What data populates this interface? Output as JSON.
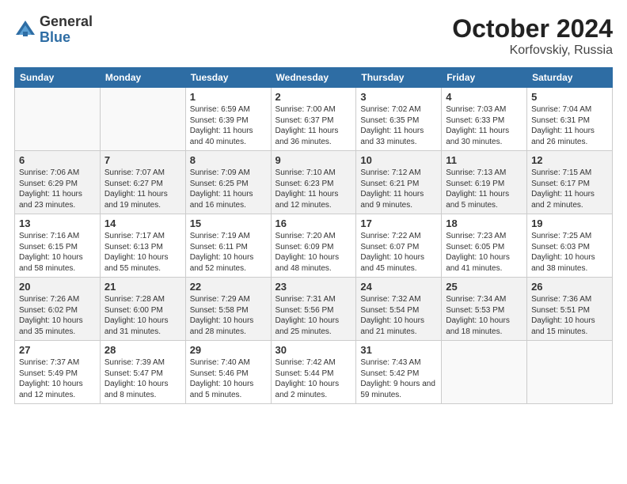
{
  "logo": {
    "general": "General",
    "blue": "Blue"
  },
  "title": "October 2024",
  "location": "Korfovskiy, Russia",
  "headers": [
    "Sunday",
    "Monday",
    "Tuesday",
    "Wednesday",
    "Thursday",
    "Friday",
    "Saturday"
  ],
  "weeks": [
    [
      {
        "day": "",
        "info": ""
      },
      {
        "day": "",
        "info": ""
      },
      {
        "day": "1",
        "info": "Sunrise: 6:59 AM\nSunset: 6:39 PM\nDaylight: 11 hours and 40 minutes."
      },
      {
        "day": "2",
        "info": "Sunrise: 7:00 AM\nSunset: 6:37 PM\nDaylight: 11 hours and 36 minutes."
      },
      {
        "day": "3",
        "info": "Sunrise: 7:02 AM\nSunset: 6:35 PM\nDaylight: 11 hours and 33 minutes."
      },
      {
        "day": "4",
        "info": "Sunrise: 7:03 AM\nSunset: 6:33 PM\nDaylight: 11 hours and 30 minutes."
      },
      {
        "day": "5",
        "info": "Sunrise: 7:04 AM\nSunset: 6:31 PM\nDaylight: 11 hours and 26 minutes."
      }
    ],
    [
      {
        "day": "6",
        "info": "Sunrise: 7:06 AM\nSunset: 6:29 PM\nDaylight: 11 hours and 23 minutes."
      },
      {
        "day": "7",
        "info": "Sunrise: 7:07 AM\nSunset: 6:27 PM\nDaylight: 11 hours and 19 minutes."
      },
      {
        "day": "8",
        "info": "Sunrise: 7:09 AM\nSunset: 6:25 PM\nDaylight: 11 hours and 16 minutes."
      },
      {
        "day": "9",
        "info": "Sunrise: 7:10 AM\nSunset: 6:23 PM\nDaylight: 11 hours and 12 minutes."
      },
      {
        "day": "10",
        "info": "Sunrise: 7:12 AM\nSunset: 6:21 PM\nDaylight: 11 hours and 9 minutes."
      },
      {
        "day": "11",
        "info": "Sunrise: 7:13 AM\nSunset: 6:19 PM\nDaylight: 11 hours and 5 minutes."
      },
      {
        "day": "12",
        "info": "Sunrise: 7:15 AM\nSunset: 6:17 PM\nDaylight: 11 hours and 2 minutes."
      }
    ],
    [
      {
        "day": "13",
        "info": "Sunrise: 7:16 AM\nSunset: 6:15 PM\nDaylight: 10 hours and 58 minutes."
      },
      {
        "day": "14",
        "info": "Sunrise: 7:17 AM\nSunset: 6:13 PM\nDaylight: 10 hours and 55 minutes."
      },
      {
        "day": "15",
        "info": "Sunrise: 7:19 AM\nSunset: 6:11 PM\nDaylight: 10 hours and 52 minutes."
      },
      {
        "day": "16",
        "info": "Sunrise: 7:20 AM\nSunset: 6:09 PM\nDaylight: 10 hours and 48 minutes."
      },
      {
        "day": "17",
        "info": "Sunrise: 7:22 AM\nSunset: 6:07 PM\nDaylight: 10 hours and 45 minutes."
      },
      {
        "day": "18",
        "info": "Sunrise: 7:23 AM\nSunset: 6:05 PM\nDaylight: 10 hours and 41 minutes."
      },
      {
        "day": "19",
        "info": "Sunrise: 7:25 AM\nSunset: 6:03 PM\nDaylight: 10 hours and 38 minutes."
      }
    ],
    [
      {
        "day": "20",
        "info": "Sunrise: 7:26 AM\nSunset: 6:02 PM\nDaylight: 10 hours and 35 minutes."
      },
      {
        "day": "21",
        "info": "Sunrise: 7:28 AM\nSunset: 6:00 PM\nDaylight: 10 hours and 31 minutes."
      },
      {
        "day": "22",
        "info": "Sunrise: 7:29 AM\nSunset: 5:58 PM\nDaylight: 10 hours and 28 minutes."
      },
      {
        "day": "23",
        "info": "Sunrise: 7:31 AM\nSunset: 5:56 PM\nDaylight: 10 hours and 25 minutes."
      },
      {
        "day": "24",
        "info": "Sunrise: 7:32 AM\nSunset: 5:54 PM\nDaylight: 10 hours and 21 minutes."
      },
      {
        "day": "25",
        "info": "Sunrise: 7:34 AM\nSunset: 5:53 PM\nDaylight: 10 hours and 18 minutes."
      },
      {
        "day": "26",
        "info": "Sunrise: 7:36 AM\nSunset: 5:51 PM\nDaylight: 10 hours and 15 minutes."
      }
    ],
    [
      {
        "day": "27",
        "info": "Sunrise: 7:37 AM\nSunset: 5:49 PM\nDaylight: 10 hours and 12 minutes."
      },
      {
        "day": "28",
        "info": "Sunrise: 7:39 AM\nSunset: 5:47 PM\nDaylight: 10 hours and 8 minutes."
      },
      {
        "day": "29",
        "info": "Sunrise: 7:40 AM\nSunset: 5:46 PM\nDaylight: 10 hours and 5 minutes."
      },
      {
        "day": "30",
        "info": "Sunrise: 7:42 AM\nSunset: 5:44 PM\nDaylight: 10 hours and 2 minutes."
      },
      {
        "day": "31",
        "info": "Sunrise: 7:43 AM\nSunset: 5:42 PM\nDaylight: 9 hours and 59 minutes."
      },
      {
        "day": "",
        "info": ""
      },
      {
        "day": "",
        "info": ""
      }
    ]
  ]
}
